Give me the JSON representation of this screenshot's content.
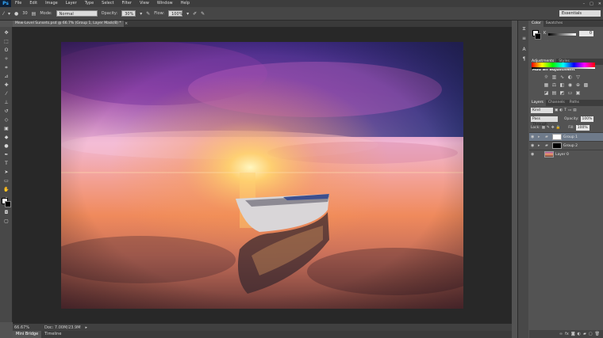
{
  "menu": {
    "logo": "Ps",
    "items": [
      "File",
      "Edit",
      "Image",
      "Layer",
      "Type",
      "Select",
      "Filter",
      "View",
      "Window",
      "Help"
    ]
  },
  "options": {
    "brush_size": "30",
    "mode_label": "Mode:",
    "mode_value": "Normal",
    "opacity_label": "Opacity:",
    "opacity_value": "30%",
    "flow_label": "Flow:",
    "flow_value": "100%",
    "workspace": "Essentials"
  },
  "document": {
    "tab_title": "Mew-Level Sunsets.psd @ 66.7% (Group 1, Layer Mask/8) *",
    "zoom": "66.67%",
    "doc_info": "Doc: 7.00M/23.9M"
  },
  "bottom_tabs": [
    "Mini Bridge",
    "Timeline"
  ],
  "color_panel": {
    "tabs": [
      "Color",
      "Swatches"
    ],
    "channel_label": "K",
    "channel_value": "0"
  },
  "adjustments_panel": {
    "tabs": [
      "Adjustments",
      "Styles"
    ],
    "title": "Add an adjustment"
  },
  "layers_panel": {
    "tabs": [
      "Layers",
      "Channels",
      "Paths"
    ],
    "filter_label": "Kind",
    "blend_mode": "Pass Through",
    "opacity_label": "Opacity:",
    "opacity_value": "100%",
    "lock_label": "Lock:",
    "fill_label": "Fill:",
    "fill_value": "100%",
    "layers": [
      {
        "name": "Group 1",
        "selected": true
      },
      {
        "name": "Group 2",
        "selected": false
      },
      {
        "name": "Layer 0",
        "selected": false
      }
    ]
  },
  "colors": {
    "accent": "#31a8ff",
    "selection": "#6e7a8a"
  }
}
